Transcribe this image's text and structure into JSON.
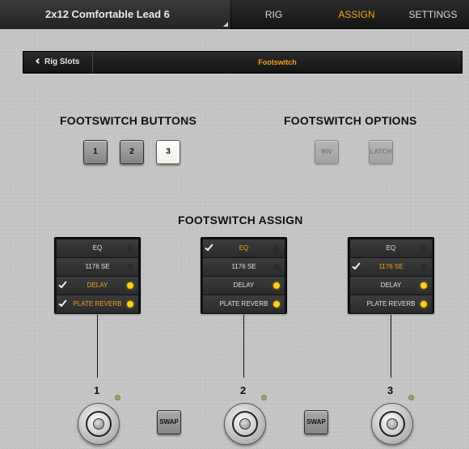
{
  "header": {
    "preset_name": "2x12 Comfortable Lead 6",
    "tabs": [
      {
        "label": "RIG",
        "active": false
      },
      {
        "label": "ASSIGN",
        "active": true
      },
      {
        "label": "SETTINGS",
        "active": false
      }
    ]
  },
  "subheader": {
    "back_label": "Rig Slots",
    "title": "Footswitch"
  },
  "footswitch_buttons": {
    "heading": "FOOTSWITCH BUTTONS",
    "buttons": [
      {
        "label": "1",
        "selected": false
      },
      {
        "label": "2",
        "selected": false
      },
      {
        "label": "3",
        "selected": true
      }
    ]
  },
  "footswitch_options": {
    "heading": "FOOTSWITCH OPTIONS",
    "buttons": [
      {
        "label": "INV",
        "enabled": false
      },
      {
        "label": "LATCH",
        "enabled": false
      }
    ]
  },
  "footswitch_assign": {
    "heading": "FOOTSWITCH ASSIGN",
    "columns": [
      {
        "number": "1",
        "items": [
          {
            "label": "EQ",
            "checked": false,
            "led_on": false
          },
          {
            "label": "1176 SE",
            "checked": false,
            "led_on": false
          },
          {
            "label": "DELAY",
            "checked": true,
            "led_on": true
          },
          {
            "label": "PLATE REVERB",
            "checked": true,
            "led_on": true
          }
        ]
      },
      {
        "number": "2",
        "items": [
          {
            "label": "EQ",
            "checked": true,
            "led_on": false
          },
          {
            "label": "1176 SE",
            "checked": false,
            "led_on": false
          },
          {
            "label": "DELAY",
            "checked": false,
            "led_on": true
          },
          {
            "label": "PLATE REVERB",
            "checked": false,
            "led_on": true
          }
        ]
      },
      {
        "number": "3",
        "items": [
          {
            "label": "EQ",
            "checked": false,
            "led_on": false
          },
          {
            "label": "1176 SE",
            "checked": true,
            "led_on": false
          },
          {
            "label": "DELAY",
            "checked": false,
            "led_on": true
          },
          {
            "label": "PLATE REVERB",
            "checked": false,
            "led_on": true
          }
        ]
      }
    ],
    "swap_label": "SWAP"
  },
  "colors": {
    "accent": "#f2a21e",
    "led_on": "#ffcf18"
  }
}
